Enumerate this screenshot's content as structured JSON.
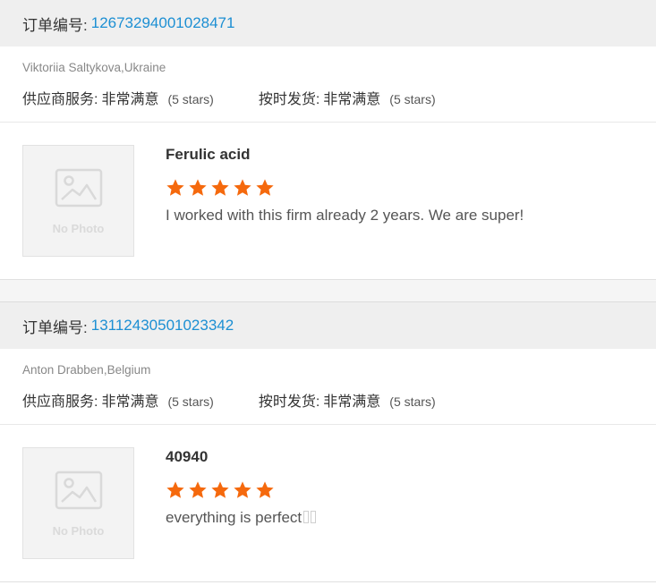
{
  "colors": {
    "order_link": "#1c8fd3",
    "star": "#f5690d"
  },
  "reviews": [
    {
      "order_label": "订单编号:",
      "order_number": "12673294001028471",
      "buyer": "Viktoriia Saltykova,Ukraine",
      "ratings": [
        {
          "label": "供应商服务:",
          "value": "非常满意",
          "stars_text": "(5 stars)"
        },
        {
          "label": "按时发货:",
          "value": "非常满意",
          "stars_text": "(5 stars)"
        }
      ],
      "product": {
        "photo_text": "No Photo",
        "name": "Ferulic acid",
        "stars": 5,
        "comment": "I worked with this firm already 2 years. We are super!"
      }
    },
    {
      "order_label": "订单编号:",
      "order_number": "13112430501023342",
      "buyer": "Anton Drabben,Belgium",
      "ratings": [
        {
          "label": "供应商服务:",
          "value": "非常满意",
          "stars_text": "(5 stars)"
        },
        {
          "label": "按时发货:",
          "value": "非常满意",
          "stars_text": "(5 stars)"
        }
      ],
      "product": {
        "photo_text": "No Photo",
        "name": "40940",
        "stars": 5,
        "comment": "everything is perfect"
      }
    }
  ]
}
